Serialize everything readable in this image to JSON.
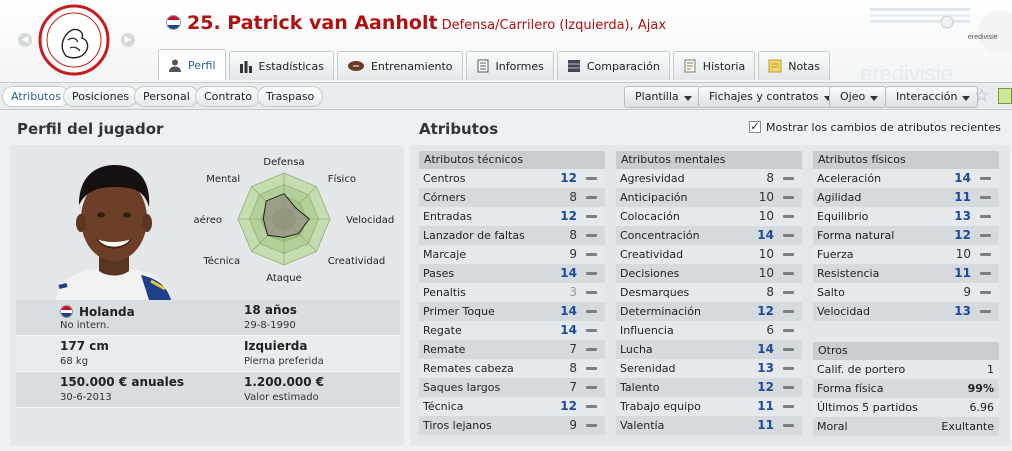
{
  "player": {
    "number_name": "25. Patrick van Aanholt",
    "role_club": "Defensa/Carrilero (Izquierda), Ajax"
  },
  "club_logo_text": "AJAX",
  "league_logo_text": "eredivisie",
  "tabs": [
    {
      "label": "Perfil",
      "icon": "person-icon",
      "active": true
    },
    {
      "label": "Estadísticas",
      "icon": "bar-chart-icon"
    },
    {
      "label": "Entrenamiento",
      "icon": "football-icon"
    },
    {
      "label": "Informes",
      "icon": "report-icon"
    },
    {
      "label": "Comparación",
      "icon": "compare-icon"
    },
    {
      "label": "Historia",
      "icon": "history-icon"
    },
    {
      "label": "Notas",
      "icon": "notes-icon"
    }
  ],
  "subtabs": [
    {
      "label": "Atributos",
      "active": true
    },
    {
      "label": "Posiciones"
    },
    {
      "label": "Personal"
    },
    {
      "label": "Contrato"
    },
    {
      "label": "Traspaso"
    }
  ],
  "menus": [
    "Plantilla",
    "Fichajes y contratos",
    "Ojeo",
    "Interacción"
  ],
  "profile": {
    "heading": "Perfil del jugador",
    "radar_labels": [
      "Defensa",
      "Físico",
      "Velocidad",
      "Creatividad",
      "Ataque",
      "Técnica",
      "Juego aéreo",
      "Mental"
    ],
    "radar_levels": [
      0.55,
      0.35,
      0.55,
      0.45,
      0.4,
      0.5,
      0.45,
      0.55
    ],
    "nationality": "Holanda",
    "intl": "No intern.",
    "age": "18 años",
    "dob": "29-8-1990",
    "height": "177 cm",
    "weight": "68 kg",
    "foot": "Izquierda",
    "foot_label": "Pierna preferida",
    "wage": "150.000 € anuales",
    "contract_end": "30-6-2013",
    "value": "1.200.000 €",
    "value_label": "Valor estimado"
  },
  "attributes": {
    "heading": "Atributos",
    "show_changes_label": "Mostrar los cambios de atributos recientes",
    "show_changes_checked": true,
    "technical": {
      "title": "Atributos técnicos",
      "items": [
        {
          "name": "Centros",
          "value": "12"
        },
        {
          "name": "Córners",
          "value": "8"
        },
        {
          "name": "Entradas",
          "value": "12"
        },
        {
          "name": "Lanzador de faltas",
          "value": "8"
        },
        {
          "name": "Marcaje",
          "value": "9"
        },
        {
          "name": "Pases",
          "value": "14"
        },
        {
          "name": "Penaltis",
          "value": "3"
        },
        {
          "name": "Primer Toque",
          "value": "14"
        },
        {
          "name": "Regate",
          "value": "14"
        },
        {
          "name": "Remate",
          "value": "7"
        },
        {
          "name": "Remates cabeza",
          "value": "8"
        },
        {
          "name": "Saques largos",
          "value": "7"
        },
        {
          "name": "Técnica",
          "value": "12"
        },
        {
          "name": "Tiros lejanos",
          "value": "9"
        }
      ]
    },
    "mental": {
      "title": "Atributos mentales",
      "items": [
        {
          "name": "Agresividad",
          "value": "8"
        },
        {
          "name": "Anticipación",
          "value": "10"
        },
        {
          "name": "Colocación",
          "value": "10"
        },
        {
          "name": "Concentración",
          "value": "14"
        },
        {
          "name": "Creatividad",
          "value": "10"
        },
        {
          "name": "Decisiones",
          "value": "10"
        },
        {
          "name": "Desmarques",
          "value": "8"
        },
        {
          "name": "Determinación",
          "value": "12"
        },
        {
          "name": "Influencia",
          "value": "6"
        },
        {
          "name": "Lucha",
          "value": "14"
        },
        {
          "name": "Serenidad",
          "value": "13"
        },
        {
          "name": "Talento",
          "value": "12"
        },
        {
          "name": "Trabajo equipo",
          "value": "11"
        },
        {
          "name": "Valentía",
          "value": "11"
        }
      ]
    },
    "physical": {
      "title": "Atributos físicos",
      "items": [
        {
          "name": "Aceleración",
          "value": "14"
        },
        {
          "name": "Agilidad",
          "value": "11"
        },
        {
          "name": "Equilibrio",
          "value": "13"
        },
        {
          "name": "Forma natural",
          "value": "12"
        },
        {
          "name": "Fuerza",
          "value": "10"
        },
        {
          "name": "Resistencia",
          "value": "11"
        },
        {
          "name": "Salto",
          "value": "9"
        },
        {
          "name": "Velocidad",
          "value": "13"
        }
      ]
    },
    "others": {
      "title": "Otros",
      "items": [
        {
          "name": "Calif. de portero",
          "value": "1"
        },
        {
          "name": "Forma física",
          "value": "99%"
        },
        {
          "name": "Últimos 5 partidos",
          "value": "6.96"
        },
        {
          "name": "Moral",
          "value": "Exultante"
        }
      ]
    }
  },
  "colors": {
    "accent_red": "#b01010",
    "highlight_blue": "#1e4a9a",
    "tab_active": "#2a5d9c"
  }
}
